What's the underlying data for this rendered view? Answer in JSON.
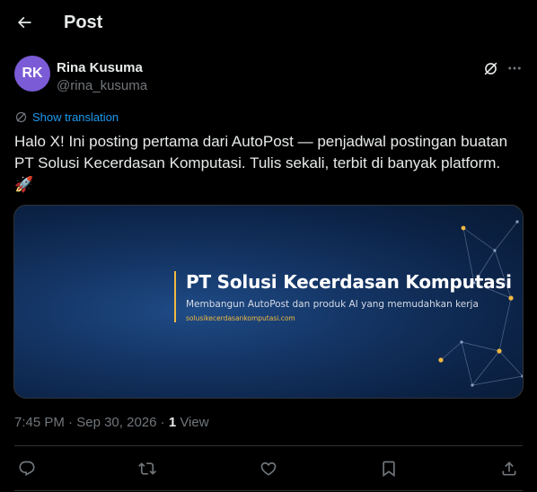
{
  "header": {
    "title": "Post",
    "back_icon": "arrow-left-icon"
  },
  "author": {
    "avatar_initials": "RK",
    "avatar_color": "#7b5bd6",
    "display_name": "Rina Kusuma",
    "handle": "@rina_kusuma"
  },
  "translate": {
    "label": "Show translation",
    "icon": "translate-icon"
  },
  "post": {
    "text": "Halo X! Ini posting pertama dari AutoPost — penjadwal postingan buatan PT Solusi Kecerdasan Komputasi. Tulis sekali, terbit di banyak platform. 🚀"
  },
  "media": {
    "title": "PT Solusi Kecerdasan Komputasi",
    "subtitle": "Membangun AutoPost dan produk AI yang memudahkan kerja",
    "url": "solusikecerdasankomputasi.com"
  },
  "meta": {
    "time": "7:45 PM",
    "date": "Sep 30, 2026",
    "views_count": "1",
    "views_label": "View",
    "sep": "·"
  },
  "actions": [
    "reply-icon",
    "repost-icon",
    "like-icon",
    "bookmark-icon",
    "share-icon"
  ],
  "colors": {
    "accent": "#1d9bf0",
    "background": "#000000",
    "text": "#e7e9ea",
    "muted": "#71767b",
    "gold": "#f0b940"
  }
}
